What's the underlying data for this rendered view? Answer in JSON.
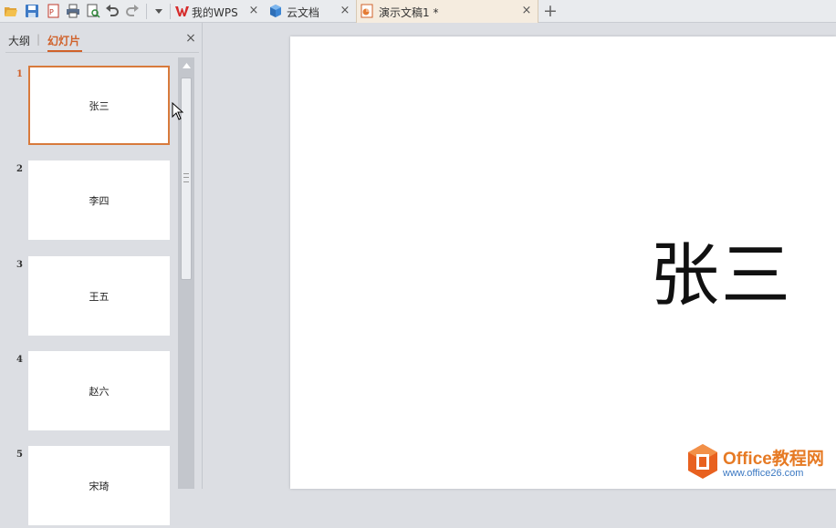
{
  "toolbar": {
    "icons": [
      "open-folder-icon",
      "save-icon",
      "export-pdf-icon",
      "print-icon",
      "print-preview-icon",
      "undo-icon",
      "redo-icon",
      "dropdown-icon"
    ]
  },
  "tabs": [
    {
      "label": "我的WPS",
      "icon": "wps-icon",
      "active": false
    },
    {
      "label": "云文档",
      "icon": "cloud-doc-icon",
      "active": false
    },
    {
      "label": "演示文稿1 *",
      "icon": "presentation-icon",
      "active": true
    }
  ],
  "panel": {
    "outline_tab": "大纲",
    "divider": "|",
    "slides_tab": "幻灯片",
    "close": "×"
  },
  "slides": [
    {
      "number": "1",
      "title": "张三",
      "selected": true
    },
    {
      "number": "2",
      "title": "李四",
      "selected": false
    },
    {
      "number": "3",
      "title": "王五",
      "selected": false
    },
    {
      "number": "4",
      "title": "赵六",
      "selected": false
    },
    {
      "number": "5",
      "title": "宋琦",
      "selected": false
    }
  ],
  "main_slide": {
    "title": "张三"
  },
  "watermark": {
    "title": "Office教程网",
    "url": "www.office26.com"
  },
  "colors": {
    "accent": "#d0612a",
    "selected_border": "#d87a3c",
    "watermark_orange": "#e67a24"
  }
}
